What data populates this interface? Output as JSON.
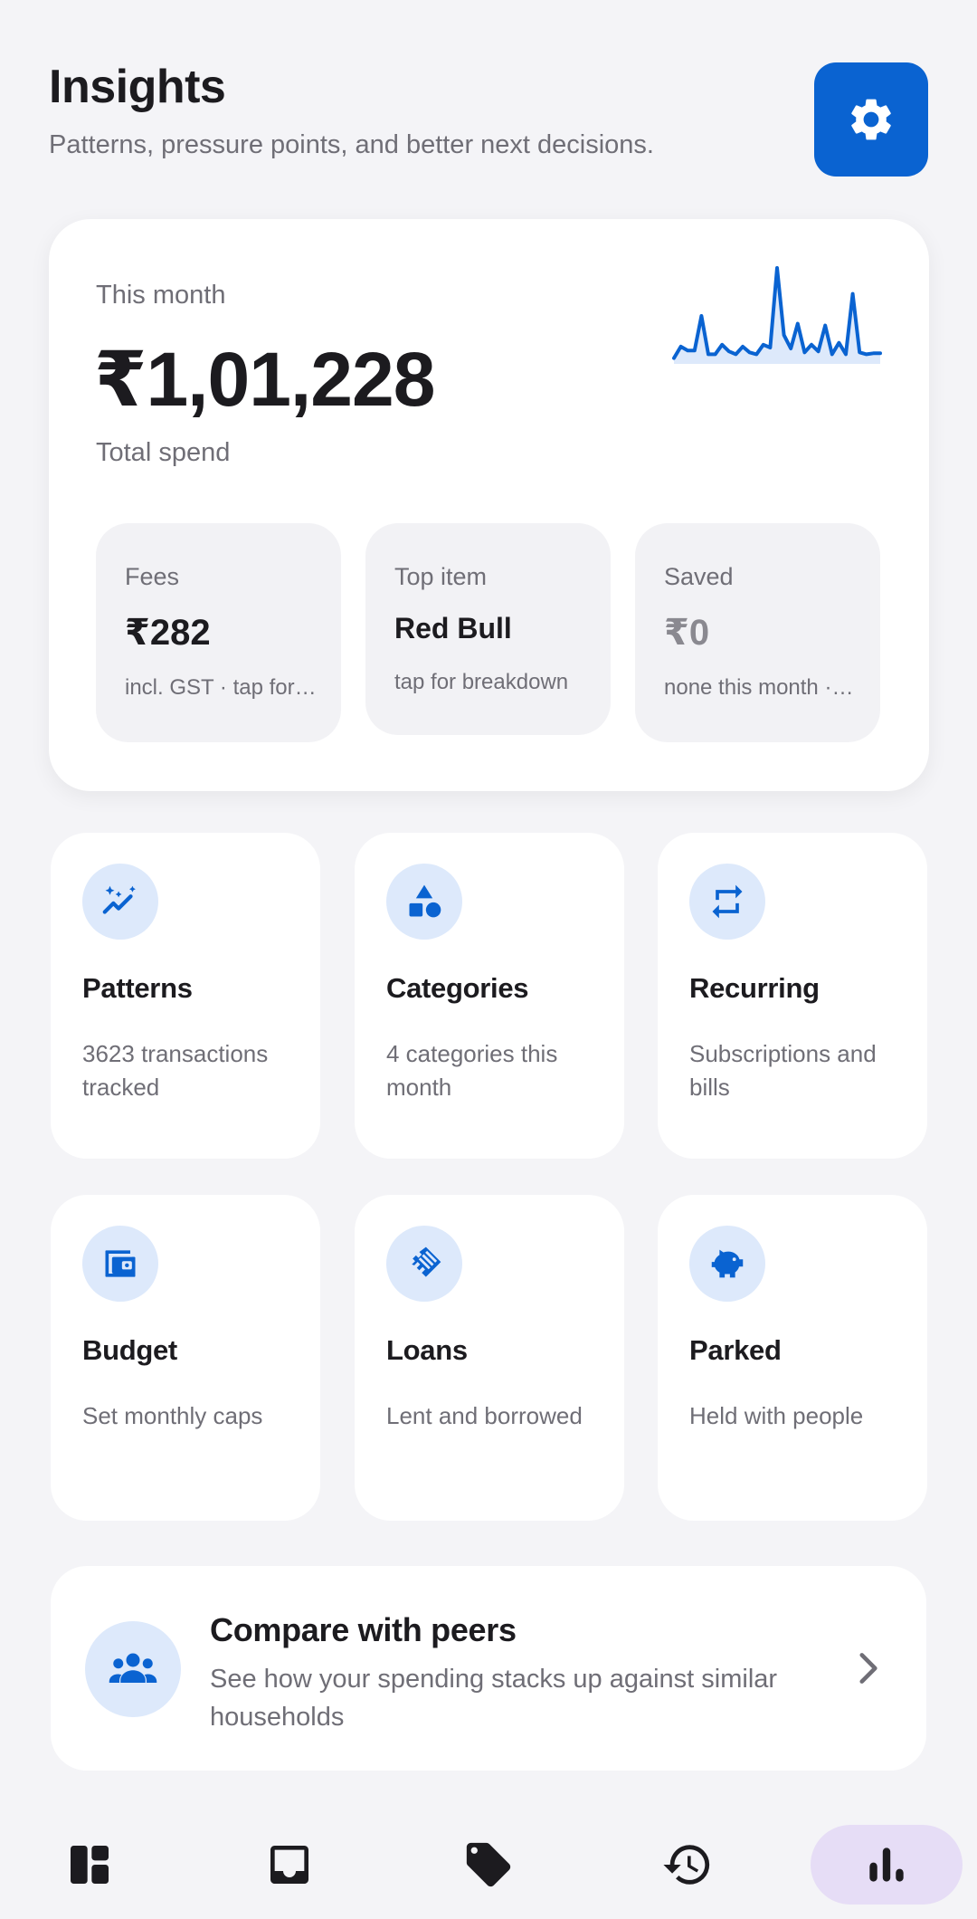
{
  "header": {
    "title": "Insights",
    "subtitle": "Patterns, pressure points, and better next decisions.",
    "settings_icon": "gear-icon"
  },
  "summary": {
    "label": "This month",
    "amount": "₹1,01,228",
    "caption": "Total spend",
    "sparkline": [
      0.06,
      0.18,
      0.14,
      0.14,
      0.5,
      0.1,
      0.1,
      0.2,
      0.13,
      0.1,
      0.18,
      0.12,
      0.1,
      0.2,
      0.17,
      1.0,
      0.3,
      0.16,
      0.42,
      0.12,
      0.2,
      0.13,
      0.4,
      0.1,
      0.22,
      0.1,
      0.73,
      0.12,
      0.1,
      0.11,
      0.11
    ],
    "accent_color": "#0a63d1"
  },
  "stats": [
    {
      "label": "Fees",
      "value": "₹282",
      "note": "incl. GST · tap for breakdown"
    },
    {
      "label": "Top item",
      "value": "Red Bull",
      "note": "tap for breakdown"
    },
    {
      "label": "Saved",
      "value": "₹0",
      "note": "none this month · tap for details"
    }
  ],
  "tiles": [
    {
      "icon": "sparkle-trend-icon",
      "title": "Patterns",
      "desc": "3623 transactions tracked"
    },
    {
      "icon": "shapes-icon",
      "title": "Categories",
      "desc": "4 categories this month"
    },
    {
      "icon": "repeat-icon",
      "title": "Recurring",
      "desc": "Subscriptions and bills"
    },
    {
      "icon": "wallet-icon",
      "title": "Budget",
      "desc": "Set monthly caps"
    },
    {
      "icon": "handshake-icon",
      "title": "Loans",
      "desc": "Lent and borrowed"
    },
    {
      "icon": "piggy-bank-icon",
      "title": "Parked",
      "desc": "Held with people"
    }
  ],
  "peers": {
    "icon": "people-group-icon",
    "title": "Compare with peers",
    "desc": "See how your spending stacks up against similar households"
  },
  "nav": [
    {
      "icon": "dashboard-icon",
      "active": false
    },
    {
      "icon": "inbox-icon",
      "active": false
    },
    {
      "icon": "tag-icon",
      "active": false
    },
    {
      "icon": "history-icon",
      "active": false
    },
    {
      "icon": "bar-chart-icon",
      "active": true
    }
  ]
}
